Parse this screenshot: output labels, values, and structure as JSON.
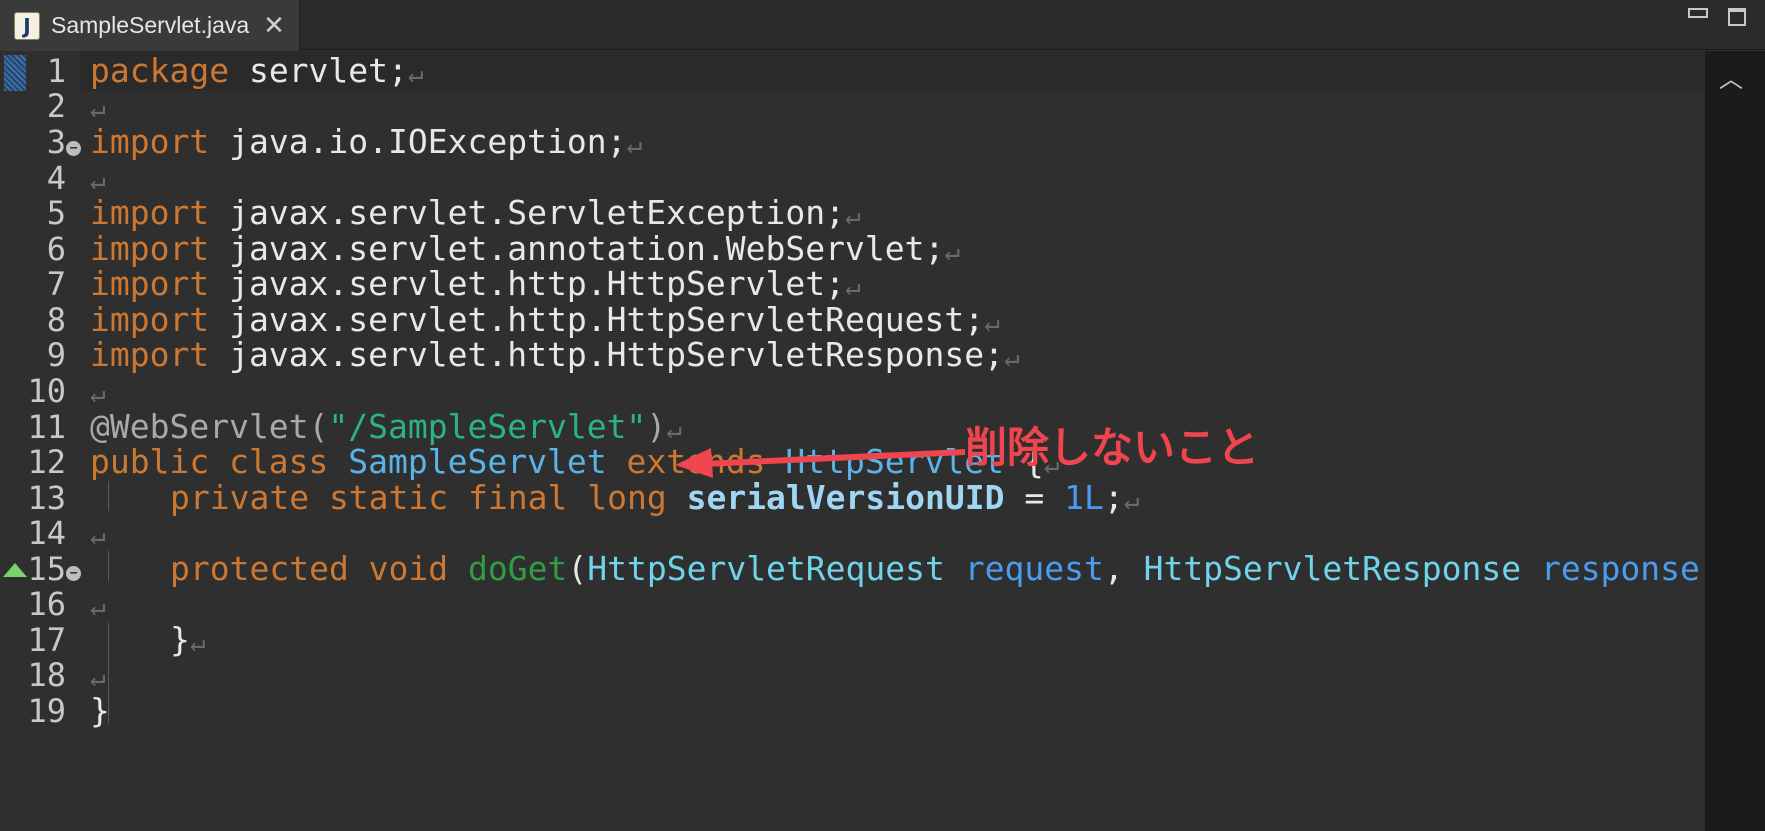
{
  "tab": {
    "title": "SampleServlet.java",
    "icon_letter": "J",
    "close_glyph": "✕"
  },
  "window_controls": {
    "minimize": "minimize",
    "maximize": "maximize"
  },
  "scrollbar": {
    "up_glyph": "︿"
  },
  "line_numbers": [
    "1",
    "2",
    "3",
    "4",
    "5",
    "6",
    "7",
    "8",
    "9",
    "10",
    "11",
    "12",
    "13",
    "14",
    "15",
    "16",
    "17",
    "18",
    "19"
  ],
  "code": {
    "l1": {
      "kw": "package",
      "rest": " servlet;"
    },
    "l3": {
      "kw": "import",
      "rest": " java.io.IOException;"
    },
    "l5": {
      "kw": "import",
      "rest": " javax.servlet.ServletException;"
    },
    "l6": {
      "kw": "import",
      "rest": " javax.servlet.annotation.WebServlet;"
    },
    "l7": {
      "kw": "import",
      "rest": " javax.servlet.http.HttpServlet;"
    },
    "l8": {
      "kw": "import",
      "rest": " javax.servlet.http.HttpServletRequest;"
    },
    "l9": {
      "kw": "import",
      "rest": " javax.servlet.http.HttpServletResponse;"
    },
    "l11": {
      "anno": "@WebServlet(",
      "str": "\"/SampleServlet\"",
      "close": ")"
    },
    "l12": {
      "kw1": "public class",
      "cls": "SampleServlet",
      "kw2": "extends",
      "sup": "HttpServlet",
      "brace": " {"
    },
    "l13": {
      "kw": "private static final long",
      "field": "serialVersionUID",
      "eq": " = ",
      "num": "1L",
      "semi": ";"
    },
    "l15": {
      "kw": "protected void",
      "method": "doGet",
      "paren": "(",
      "t1": "HttpServletRequest",
      "p1": "request",
      "comma": ", ",
      "t2": "HttpServletResponse",
      "p2": "response"
    },
    "l17": {
      "brace": "}"
    },
    "l19": {
      "brace": "}"
    }
  },
  "eol_glyph": "↵",
  "annotation": {
    "text": "削除しないこと",
    "color": "#f0454e"
  },
  "colors": {
    "keyword": "#cc7832",
    "type": "#5ab4e8",
    "string": "#2bb28a",
    "method": "#2f9e44",
    "background": "#2f2f2f"
  }
}
